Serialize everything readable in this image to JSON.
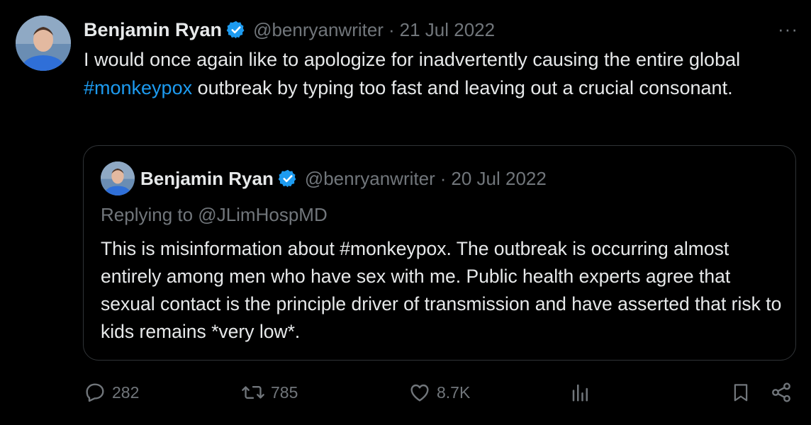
{
  "tweet": {
    "author": {
      "name": "Benjamin Ryan",
      "handle": "@benryanwriter",
      "separator": "·",
      "date": "21 Jul 2022",
      "verified_color": "#1d9bf0"
    },
    "more_label": "···",
    "text_before": "I would once again like to apologize for inadvertently causing the entire global ",
    "hashtag": "#monkeypox",
    "text_after": " outbreak by typing too fast and leaving out a crucial consonant."
  },
  "quoted": {
    "author": {
      "name": "Benjamin Ryan",
      "handle": "@benryanwriter",
      "separator": "·",
      "date": "20 Jul 2022"
    },
    "reply_to": "Replying to @JLimHospMD",
    "text": "This is misinformation about #monkeypox. The outbreak is occurring almost entirely among men who have sex with me. Public health experts agree that sexual contact is the principle driver of transmission and have asserted that risk to kids remains *very low*."
  },
  "actions": {
    "replies": "282",
    "reposts": "785",
    "likes": "8.7K"
  },
  "colors": {
    "background": "#000000",
    "text": "#e7e9ea",
    "muted": "#71767b",
    "accent": "#1d9bf0",
    "border": "#2f3336"
  }
}
